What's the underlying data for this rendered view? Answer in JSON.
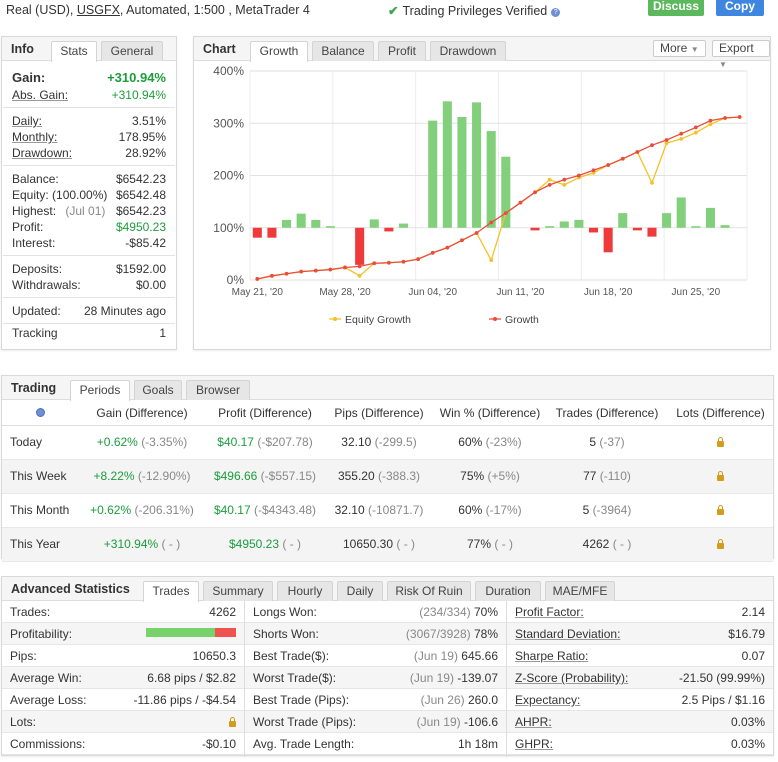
{
  "header": {
    "account_prefix": "Real (USD),",
    "broker": "USGFX",
    "account_suffix": ", Automated, 1:500 , MetaTrader 4",
    "verified_text": "Trading Privileges Verified",
    "discuss_label": "Discuss",
    "copy_label": "Copy"
  },
  "info": {
    "title": "Info",
    "tabs": [
      "Stats",
      "General"
    ],
    "gain_label": "Gain:",
    "gain_value": "+310.94%",
    "abs_gain_label": "Abs. Gain:",
    "abs_gain_value": "+310.94%",
    "daily_label": "Daily:",
    "daily_value": "3.51%",
    "monthly_label": "Monthly:",
    "monthly_value": "178.95%",
    "drawdown_label": "Drawdown:",
    "drawdown_value": "28.92%",
    "balance_label": "Balance:",
    "balance_value": "$6542.23",
    "equity_label": "Equity:",
    "equity_pct": "(100.00%)",
    "equity_value": "$6542.48",
    "highest_label": "Highest:",
    "highest_date": "(Jul 01)",
    "highest_value": "$6542.23",
    "profit_label": "Profit:",
    "profit_value": "$4950.23",
    "interest_label": "Interest:",
    "interest_value": "-$85.42",
    "deposits_label": "Deposits:",
    "deposits_value": "$1592.00",
    "withdrawals_label": "Withdrawals:",
    "withdrawals_value": "$0.00",
    "updated_label": "Updated:",
    "updated_value": "28 Minutes ago",
    "tracking_label": "Tracking",
    "tracking_value": "1"
  },
  "chart": {
    "title": "Chart",
    "tabs": [
      "Growth",
      "Balance",
      "Profit",
      "Drawdown"
    ],
    "more_label": "More",
    "export_label": "Export"
  },
  "chart_data": {
    "type": "bar",
    "y_ticks": [
      "400%",
      "300%",
      "200%",
      "100%",
      "0%"
    ],
    "ylim": [
      0,
      400
    ],
    "x_tick_labels": [
      "May 21, '20",
      "May 28, '20",
      "Jun 04, '20",
      "Jun 11, '20",
      "Jun 18, '20",
      "Jun 25, '20"
    ],
    "x_tick_index": [
      0,
      6,
      12,
      18,
      24,
      30
    ],
    "bars": [
      -19,
      -19,
      15,
      27,
      15,
      3,
      -71,
      16,
      -7,
      8,
      205,
      242,
      212,
      240,
      185,
      136,
      -5,
      3,
      12,
      15,
      -9,
      -47,
      28,
      -5,
      -17,
      28,
      58,
      3,
      38,
      5
    ],
    "bar_x_index": [
      0,
      1,
      2,
      3,
      4,
      5,
      7,
      8,
      9,
      10,
      12,
      13,
      14,
      15,
      16,
      17,
      19,
      20,
      21,
      22,
      23,
      24,
      25,
      26,
      27,
      28,
      29,
      30,
      31,
      32
    ],
    "series": [
      {
        "name": "Equity Growth",
        "color": "#f4c224",
        "values": [
          2,
          8,
          12,
          16,
          18,
          20,
          24,
          8,
          32,
          33,
          35,
          40,
          52,
          62,
          76,
          90,
          38,
          128,
          148,
          168,
          192,
          182,
          196,
          205,
          220,
          232,
          245,
          186,
          262,
          270,
          282,
          298,
          310,
          312
        ]
      },
      {
        "name": "Growth",
        "color": "#e84d3d",
        "values": [
          2,
          8,
          12,
          16,
          18,
          20,
          24,
          26,
          32,
          33,
          35,
          40,
          52,
          62,
          76,
          90,
          110,
          128,
          148,
          168,
          182,
          192,
          200,
          210,
          220,
          232,
          245,
          258,
          268,
          280,
          292,
          305,
          310,
          312
        ]
      }
    ]
  },
  "trading": {
    "title": "Trading",
    "tabs": [
      "Periods",
      "Goals",
      "Browser"
    ],
    "headers": [
      "Gain (Difference)",
      "Profit (Difference)",
      "Pips (Difference)",
      "Win % (Difference)",
      "Trades (Difference)",
      "Lots (Difference)"
    ],
    "rows": [
      {
        "period": "Today",
        "gain": "+0.62%",
        "gain_diff": "(-3.35%)",
        "profit": "$40.17",
        "profit_diff": "(-$207.78)",
        "pips": "32.10",
        "pips_diff": "(-299.5)",
        "win": "60%",
        "win_diff": "(-23%)",
        "trades": "5",
        "trades_diff": "(-37)"
      },
      {
        "period": "This Week",
        "gain": "+8.22%",
        "gain_diff": "(-12.90%)",
        "profit": "$496.66",
        "profit_diff": "(-$557.15)",
        "pips": "355.20",
        "pips_diff": "(-388.3)",
        "win": "75%",
        "win_diff": "(+5%)",
        "trades": "77",
        "trades_diff": "(-110)"
      },
      {
        "period": "This Month",
        "gain": "+0.62%",
        "gain_diff": "(-206.31%)",
        "profit": "$40.17",
        "profit_diff": "(-$4343.48)",
        "pips": "32.10",
        "pips_diff": "(-10871.7)",
        "win": "60%",
        "win_diff": "(-17%)",
        "trades": "5",
        "trades_diff": "(-3964)"
      },
      {
        "period": "This Year",
        "gain": "+310.94%",
        "gain_diff": "( - )",
        "profit": "$4950.23",
        "profit_diff": "( - )",
        "pips": "10650.30",
        "pips_diff": "( - )",
        "win": "77%",
        "win_diff": "( - )",
        "trades": "4262",
        "trades_diff": "( - )"
      }
    ]
  },
  "advanced": {
    "title": "Advanced Statistics",
    "tabs": [
      "Trades",
      "Summary",
      "Hourly",
      "Daily",
      "Risk Of Ruin",
      "Duration",
      "MAE/MFE"
    ],
    "profitability_win_fraction": 0.77,
    "col1": [
      {
        "label": "Trades:",
        "value": "4262"
      },
      {
        "label": "Profitability:",
        "value": ""
      },
      {
        "label": "Pips:",
        "value": "10650.3"
      },
      {
        "label": "Average Win:",
        "value": "6.68 pips / $2.82"
      },
      {
        "label": "Average Loss:",
        "value": "-11.86 pips / -$4.54"
      },
      {
        "label": "Lots:",
        "value": ""
      },
      {
        "label": "Commissions:",
        "value": "-$0.10"
      }
    ],
    "col2": [
      {
        "label": "Longs Won:",
        "detail": "(234/334)",
        "value": "70%"
      },
      {
        "label": "Shorts Won:",
        "detail": "(3067/3928)",
        "value": "78%"
      },
      {
        "label": "Best Trade($):",
        "detail": "(Jun 19)",
        "value": "645.66"
      },
      {
        "label": "Worst Trade($):",
        "detail": "(Jun 19)",
        "value": "-139.07"
      },
      {
        "label": "Best Trade (Pips):",
        "detail": "(Jun 26)",
        "value": "260.0"
      },
      {
        "label": "Worst Trade (Pips):",
        "detail": "(Jun 19)",
        "value": "-106.6"
      },
      {
        "label": "Avg. Trade Length:",
        "detail": "",
        "value": "1h 18m"
      }
    ],
    "col3": [
      {
        "label": "Profit Factor:",
        "value": "2.14"
      },
      {
        "label": "Standard Deviation:",
        "value": "$16.79"
      },
      {
        "label": "Sharpe Ratio:",
        "value": "0.07"
      },
      {
        "label": "Z-Score (Probability):",
        "value": "-21.50 (99.99%)"
      },
      {
        "label": "Expectancy:",
        "value": "2.5 Pips / $1.16"
      },
      {
        "label": "AHPR:",
        "value": "0.03%"
      },
      {
        "label": "GHPR:",
        "value": "0.03%"
      }
    ]
  }
}
